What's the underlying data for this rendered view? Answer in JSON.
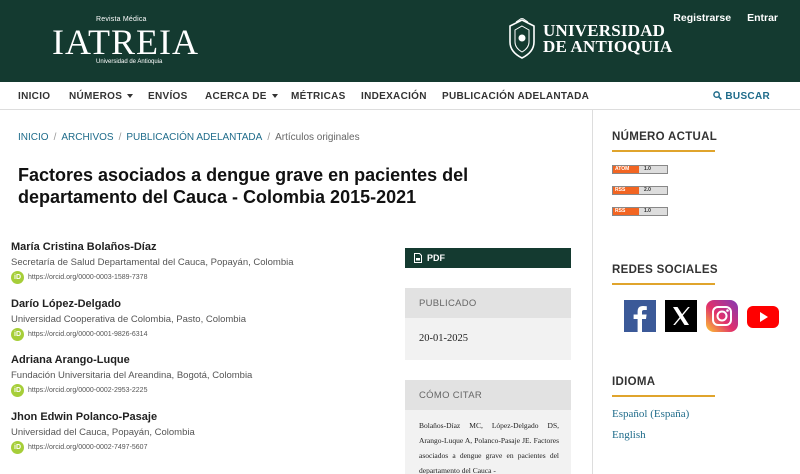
{
  "header": {
    "logo_top": "Revista Médica",
    "logo_main": "IATREIA",
    "logo_bottom": "Universidad de Antioquia",
    "university_line1": "UNIVERSIDAD",
    "university_line2": "DE ANTIOQUIA",
    "register_label": "Registrarse",
    "login_label": "Entrar"
  },
  "nav": {
    "items": [
      "INICIO",
      "NÚMEROS",
      "ENVÍOS",
      "ACERCA DE",
      "MÉTRICAS",
      "INDEXACIÓN",
      "PUBLICACIÓN ADELANTADA"
    ],
    "search_label": "BUSCAR"
  },
  "breadcrumb": {
    "items": [
      "INICIO",
      "ARCHIVOS",
      "PUBLICACIÓN ADELANTADA"
    ],
    "current": "Artículos originales"
  },
  "article": {
    "title": "Factores asociados a dengue grave en pacientes del departamento del Cauca - Colombia 2015-2021",
    "authors": [
      {
        "name": "María Cristina Bolaños-Díaz",
        "affiliation": "Secretaría de Salud Departamental del Cauca, Popayán, Colombia",
        "orcid": "https://orcid.org/0000-0003-1589-7378"
      },
      {
        "name": "Darío López-Delgado",
        "affiliation": "Universidad Cooperativa de Colombia, Pasto, Colombia",
        "orcid": "https://orcid.org/0000-0001-9826-6314"
      },
      {
        "name": "Adriana Arango-Luque",
        "affiliation": "Fundación Universitaria del Areandina, Bogotá, Colombia",
        "orcid": "https://orcid.org/0000-0002-2953-2225"
      },
      {
        "name": "Jhon Edwin Polanco-Pasaje",
        "affiliation": "Universidad del Cauca, Popayán, Colombia",
        "orcid": "https://orcid.org/0000-0002-7497-5607"
      }
    ],
    "orcid_badge": "iD",
    "pdf_label": "PDF",
    "published_heading": "PUBLICADO",
    "published_date": "20-01-2025",
    "cite_heading": "CÓMO CITAR",
    "cite_text": "Bolaños-Díaz MC, López-Delgado DS, Arango-Luque A, Polanco-Pasaje JE. Factores asociados a dengue grave en pacientes del departamento del Cauca -"
  },
  "sidebar": {
    "current_issue_heading": "NÚMERO ACTUAL",
    "feeds": [
      {
        "type": "ATOM",
        "version": "1.0"
      },
      {
        "type": "RSS",
        "version": "2.0"
      },
      {
        "type": "RSS",
        "version": "1.0"
      }
    ],
    "social_heading": "REDES SOCIALES",
    "social_icons": [
      "facebook-icon",
      "x-icon",
      "instagram-icon",
      "youtube-icon"
    ],
    "language_heading": "IDIOMA",
    "languages": [
      "Español (España)",
      "English"
    ]
  },
  "colors": {
    "header_bg": "#143a30",
    "accent_underline": "#e0a42c",
    "link": "#1e6b8a",
    "orcid_green": "#a6ce39"
  }
}
